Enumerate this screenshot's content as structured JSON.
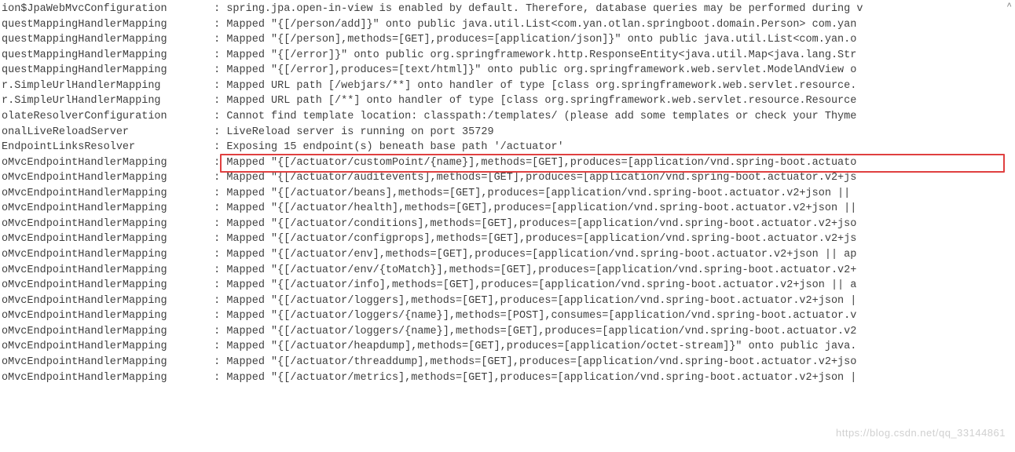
{
  "log_lines": [
    {
      "logger": "ion$JpaWebMvcConfiguration",
      "message": "spring.jpa.open-in-view is enabled by default. Therefore, database queries may be performed during v"
    },
    {
      "logger": "questMappingHandlerMapping",
      "message": "Mapped \"{[/person/add]}\" onto public java.util.List<com.yan.otlan.springboot.domain.Person> com.yan"
    },
    {
      "logger": "questMappingHandlerMapping",
      "message": "Mapped \"{[/person],methods=[GET],produces=[application/json]}\" onto public java.util.List<com.yan.o"
    },
    {
      "logger": "questMappingHandlerMapping",
      "message": "Mapped \"{[/error]}\" onto public org.springframework.http.ResponseEntity<java.util.Map<java.lang.Str"
    },
    {
      "logger": "questMappingHandlerMapping",
      "message": "Mapped \"{[/error],produces=[text/html]}\" onto public org.springframework.web.servlet.ModelAndView o"
    },
    {
      "logger": "r.SimpleUrlHandlerMapping",
      "message": "Mapped URL path [/webjars/**] onto handler of type [class org.springframework.web.servlet.resource."
    },
    {
      "logger": "r.SimpleUrlHandlerMapping",
      "message": "Mapped URL path [/**] onto handler of type [class org.springframework.web.servlet.resource.Resource"
    },
    {
      "logger": "olateResolverConfiguration",
      "message": "Cannot find template location: classpath:/templates/ (please add some templates or check your Thyme"
    },
    {
      "logger": "onalLiveReloadServer",
      "message": "LiveReload server is running on port 35729"
    },
    {
      "logger": "EndpointLinksResolver",
      "message": "Exposing 15 endpoint(s) beneath base path '/actuator'"
    },
    {
      "logger": "oMvcEndpointHandlerMapping",
      "message": "Mapped \"{[/actuator/customPoint/{name}],methods=[GET],produces=[application/vnd.spring-boot.actuato",
      "highlighted": true
    },
    {
      "logger": "oMvcEndpointHandlerMapping",
      "message": "Mapped \"{[/actuator/auditevents],methods=[GET],produces=[application/vnd.spring-boot.actuator.v2+js"
    },
    {
      "logger": "oMvcEndpointHandlerMapping",
      "message": "Mapped \"{[/actuator/beans],methods=[GET],produces=[application/vnd.spring-boot.actuator.v2+json || "
    },
    {
      "logger": "oMvcEndpointHandlerMapping",
      "message": "Mapped \"{[/actuator/health],methods=[GET],produces=[application/vnd.spring-boot.actuator.v2+json ||"
    },
    {
      "logger": "oMvcEndpointHandlerMapping",
      "message": "Mapped \"{[/actuator/conditions],methods=[GET],produces=[application/vnd.spring-boot.actuator.v2+jso"
    },
    {
      "logger": "oMvcEndpointHandlerMapping",
      "message": "Mapped \"{[/actuator/configprops],methods=[GET],produces=[application/vnd.spring-boot.actuator.v2+js"
    },
    {
      "logger": "oMvcEndpointHandlerMapping",
      "message": "Mapped \"{[/actuator/env],methods=[GET],produces=[application/vnd.spring-boot.actuator.v2+json || ap"
    },
    {
      "logger": "oMvcEndpointHandlerMapping",
      "message": "Mapped \"{[/actuator/env/{toMatch}],methods=[GET],produces=[application/vnd.spring-boot.actuator.v2+"
    },
    {
      "logger": "oMvcEndpointHandlerMapping",
      "message": "Mapped \"{[/actuator/info],methods=[GET],produces=[application/vnd.spring-boot.actuator.v2+json || a"
    },
    {
      "logger": "oMvcEndpointHandlerMapping",
      "message": "Mapped \"{[/actuator/loggers],methods=[GET],produces=[application/vnd.spring-boot.actuator.v2+json |"
    },
    {
      "logger": "oMvcEndpointHandlerMapping",
      "message": "Mapped \"{[/actuator/loggers/{name}],methods=[POST],consumes=[application/vnd.spring-boot.actuator.v"
    },
    {
      "logger": "oMvcEndpointHandlerMapping",
      "message": "Mapped \"{[/actuator/loggers/{name}],methods=[GET],produces=[application/vnd.spring-boot.actuator.v2"
    },
    {
      "logger": "oMvcEndpointHandlerMapping",
      "message": "Mapped \"{[/actuator/heapdump],methods=[GET],produces=[application/octet-stream]}\" onto public java."
    },
    {
      "logger": "oMvcEndpointHandlerMapping",
      "message": "Mapped \"{[/actuator/threaddump],methods=[GET],produces=[application/vnd.spring-boot.actuator.v2+jso"
    },
    {
      "logger": "oMvcEndpointHandlerMapping",
      "message": "Mapped \"{[/actuator/metrics],methods=[GET],produces=[application/vnd.spring-boot.actuator.v2+json |"
    }
  ],
  "separator": " : ",
  "scroll_indicator": "^",
  "watermark": "https://blog.csdn.net/qq_33144861"
}
